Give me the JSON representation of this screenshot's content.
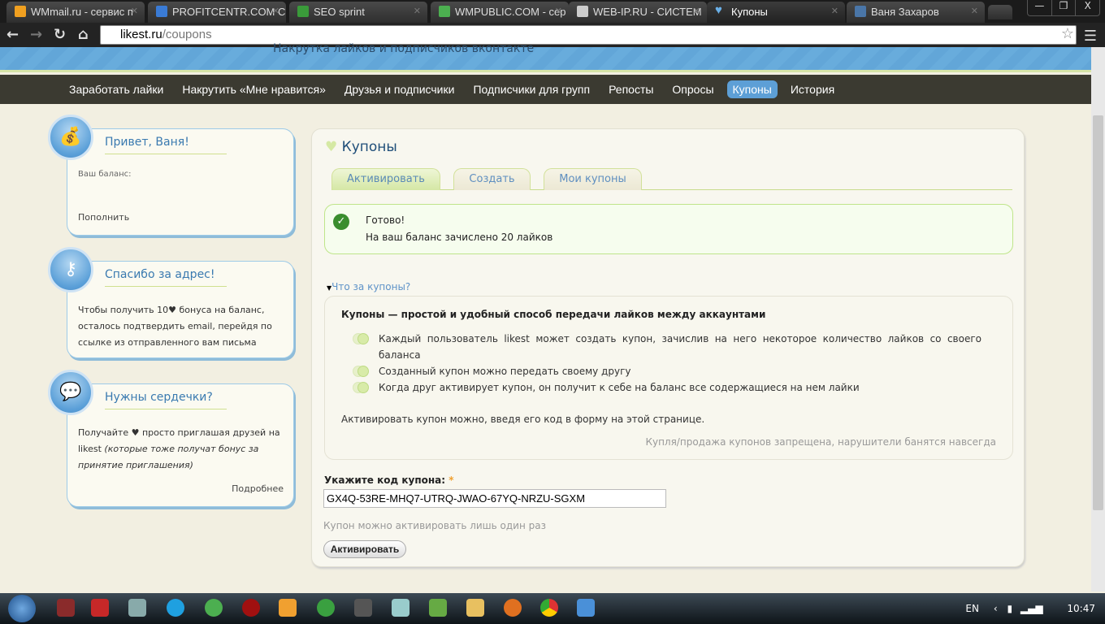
{
  "browser": {
    "tabs": [
      {
        "label": "WMmail.ru - сервис п",
        "color": "#f0a020"
      },
      {
        "label": "PROFITCENTR.COM С",
        "color": "#3a7bd5"
      },
      {
        "label": "SEO sprint",
        "color": "#3a9a3a"
      },
      {
        "label": "WMPUBLIC.COM - сер",
        "color": "#4caf50"
      },
      {
        "label": "WEB-IP.RU - СИСТЕМ",
        "color": "#ccc"
      },
      {
        "label": "Купоны",
        "color": "#6ab0e8"
      },
      {
        "label": "Ваня Захаров",
        "color": "#4a76a8"
      }
    ],
    "url_host": "likest.ru",
    "url_path": "/coupons",
    "window_buttons": [
      "—",
      "❐",
      "X"
    ]
  },
  "site": {
    "tagline": "Накрутка лайков и подписчиков вконтакте",
    "nav": [
      "Заработать лайки",
      "Накрутить «Мне нравится»",
      "Друзья и подписчики",
      "Подписчики для групп",
      "Репосты",
      "Опросы",
      "Купоны",
      "История"
    ],
    "active_nav": 6
  },
  "sidebar": {
    "greeting": {
      "title": "Привет, Ваня!",
      "balance_label": "Ваш баланс:",
      "topup": "Пополнить"
    },
    "address": {
      "title": "Спасибо за адрес!",
      "text": "Чтобы получить 10♥ бонуса на баланс, осталось подтвердить email, перейдя по ссылке из отправленного вам письма"
    },
    "hearts": {
      "title": "Нужны сердечки?",
      "text": "Получайте ♥ просто приглашая друзей на likest ",
      "italic": "(которые тоже получат бонус за принятие приглашения)",
      "more": "Подробнее"
    }
  },
  "main": {
    "title": "Купоны",
    "tabs": [
      "Активировать",
      "Создать",
      "Мои купоны"
    ],
    "success": {
      "title": "Готово!",
      "text": "На ваш баланс зачислено 20 лайков"
    },
    "what_link": "Что за купоны?",
    "info": {
      "heading": "Купоны — простой и удобный способ передачи лайков между аккаунтами",
      "items": [
        "Каждый пользователь likest может создать купон, зачислив на него некоторое количество лайков со своего баланса",
        "Созданный купон можно передать своему другу",
        "Когда друг активирует купон, он получит к себе на баланс все содержащиеся на нем лайки"
      ],
      "activate_note": "Активировать купон можно, введя его код в форму на этой странице.",
      "warning": "Купля/продажа купонов запрещена, нарушители банятся навсегда"
    },
    "form": {
      "label": "Укажите код купона:",
      "required": "*",
      "code": "GX4Q-53RE-MHQ7-UTRQ-JWAO-67YQ-NRZU-SGXM",
      "hint": "Купон можно активировать лишь один раз",
      "button": "Активировать"
    }
  },
  "taskbar": {
    "lang": "EN",
    "time": "10:47"
  }
}
